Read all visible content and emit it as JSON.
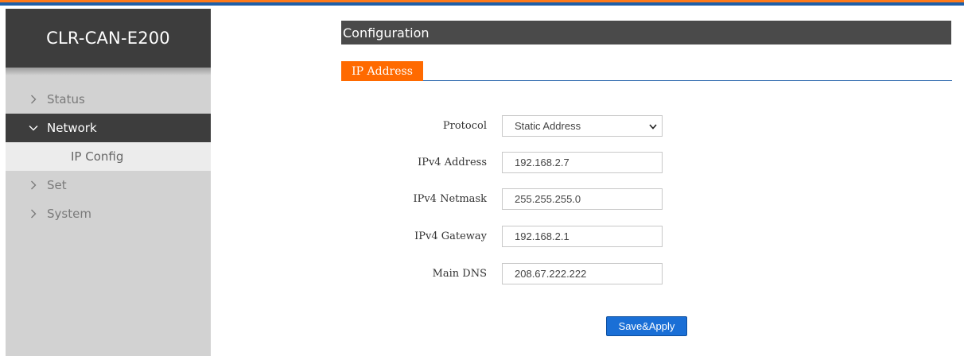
{
  "colors": {
    "accent_orange": "#ff6a00",
    "accent_blue": "#1f5fa8",
    "sidebar_bg": "#d2d2d2",
    "sidebar_dark": "#3d3d3d",
    "button_blue": "#1a6fd6"
  },
  "sidebar": {
    "brand": "CLR-CAN-E200",
    "items": [
      {
        "label": "Status",
        "icon": "chevron-right-icon",
        "expanded": false
      },
      {
        "label": "Network",
        "icon": "chevron-down-icon",
        "expanded": true,
        "active": true,
        "children": [
          {
            "label": "IP Config"
          }
        ]
      },
      {
        "label": "Set",
        "icon": "chevron-right-icon",
        "expanded": false
      },
      {
        "label": "System",
        "icon": "chevron-right-icon",
        "expanded": false
      }
    ]
  },
  "header": {
    "title": "Configuration"
  },
  "tabs": [
    {
      "label": "IP Address",
      "active": true
    }
  ],
  "form": {
    "protocol": {
      "label": "Protocol",
      "value": "Static Address",
      "icon": "chevron-down-icon"
    },
    "ipv4_address": {
      "label": "IPv4 Address",
      "value": "192.168.2.7"
    },
    "ipv4_netmask": {
      "label": "IPv4 Netmask",
      "value": "255.255.255.0"
    },
    "ipv4_gateway": {
      "label": "IPv4 Gateway",
      "value": "192.168.2.1"
    },
    "main_dns": {
      "label": "Main DNS",
      "value": "208.67.222.222"
    }
  },
  "actions": {
    "save_apply_label": "Save&Apply"
  }
}
